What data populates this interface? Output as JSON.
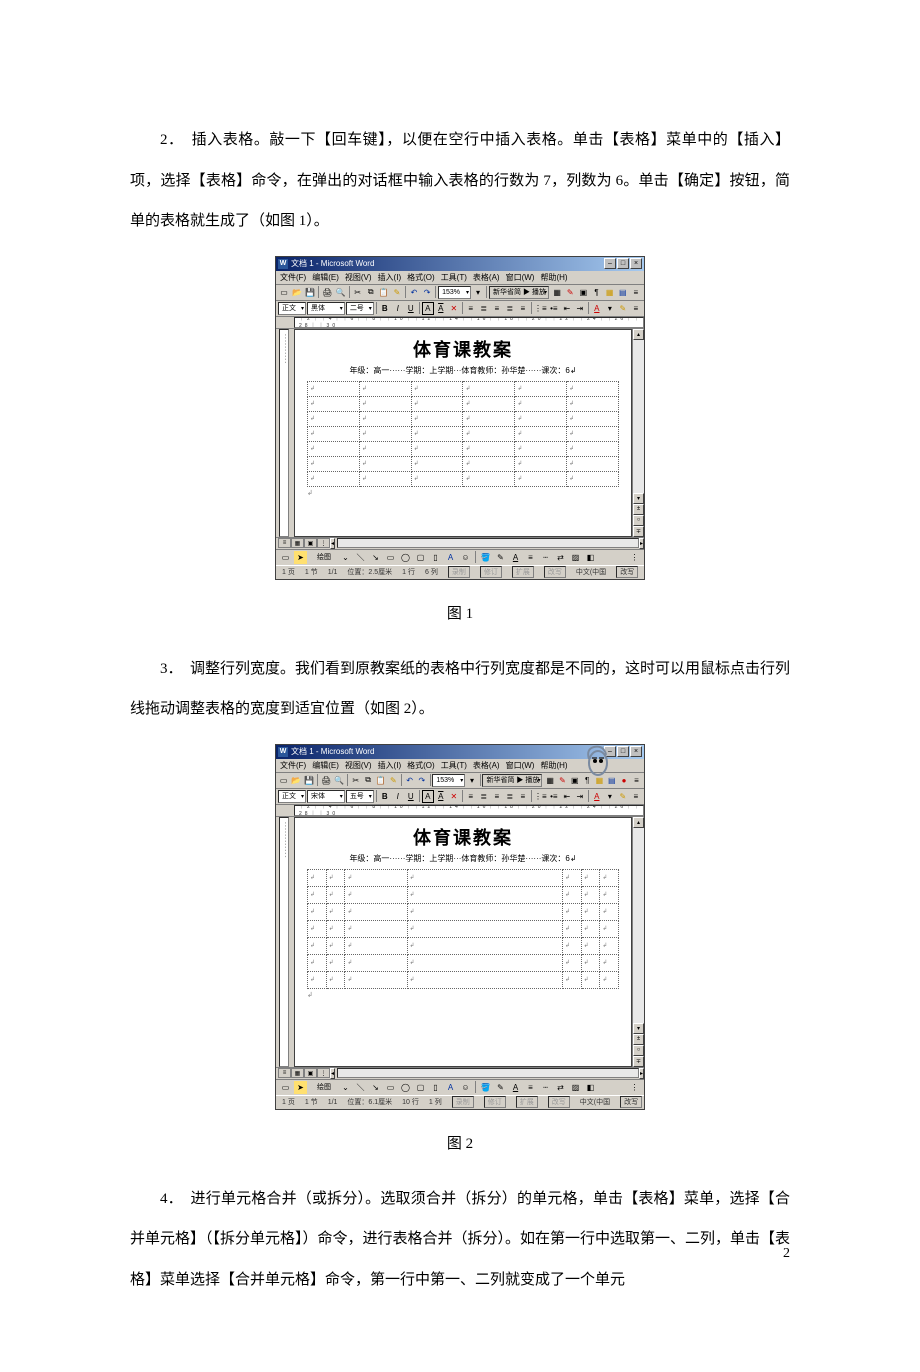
{
  "para2": "2．　插入表格。敲一下【回车键】，以便在空行中插入表格。单击【表格】菜单中的【插入】项，选择【表格】命令，在弹出的对话框中输入表格的行数为 7，列数为 6。单击【确定】按钮，简单的表格就生成了（如图 1）。",
  "para3": "3．　调整行列宽度。我们看到原教案纸的表格中行列宽度都是不同的，这时可以用鼠标点击行列线拖动调整表格的宽度到适宜位置（如图 2）。",
  "para4": "4．　进行单元格合并（或拆分）。选取须合并（拆分）的单元格，单击【表格】菜单，选择【合并单元格】（【拆分单元格】）命令，进行表格合并（拆分）。如在第一行中选取第一、二列，单击【表格】菜单选择【合并单元格】命令，第一行中第一、二列就变成了一个单元",
  "figCaption1": "图 1",
  "figCaption2": "图 2",
  "pageNumber": "2",
  "wordWindow": {
    "title": "文档 1 - Microsoft Word",
    "menus": [
      "文件(F)",
      "编辑(E)",
      "视图(V)",
      "插入(I)",
      "格式(O)",
      "工具(T)",
      "表格(A)",
      "窗口(W)",
      "帮助(H)"
    ],
    "toolbar1": {
      "zoom": "153%",
      "helperLabel": "新华省简 ▶ 播放"
    },
    "toolbar2_fig1": {
      "style": "正文",
      "font": "黑体",
      "size": "二号"
    },
    "toolbar2_fig2": {
      "style": "正文",
      "font": "宋体",
      "size": "五号"
    },
    "rulerMarks": "｜2｜｜4｜｜6｜｜8｜｜10｜｜12｜｜14｜｜16｜｜18｜｜20｜｜22｜｜24｜｜26｜｜28｜｜30",
    "docTitle": "体育课教案",
    "docSubhead": "年级：高一······学期：上学期···体育教师：孙华楚······课次：6↲",
    "drawLabel": "绘图",
    "status_fig1": {
      "page": "1 页",
      "section": "1 节",
      "pages": "1/1",
      "pos": "位置：2.5厘米",
      "line": "1 行",
      "col": "6 列",
      "lang": "中文(中国",
      "mode": "改写"
    },
    "status_fig2": {
      "page": "1 页",
      "section": "1 节",
      "pages": "1/1",
      "pos": "位置：6.1厘米",
      "line": "10 行",
      "col": "1 列",
      "lang": "中文(中国",
      "mode": "改写"
    }
  }
}
